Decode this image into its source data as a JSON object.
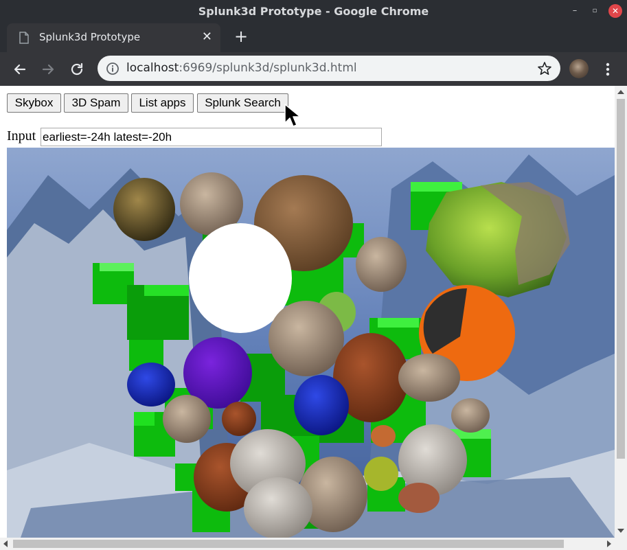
{
  "window": {
    "title": "Splunk3d Prototype - Google Chrome"
  },
  "tab": {
    "title": "Splunk3d Prototype"
  },
  "omnibox": {
    "host": "localhost",
    "rest": ":6969/splunk3d/splunk3d.html"
  },
  "page": {
    "buttons": {
      "skybox": "Skybox",
      "spam": "3D Spam",
      "list_apps": "List apps",
      "splunk_search": "Splunk Search"
    },
    "input_label": "Input",
    "input_value": "earliest=-24h latest=-20h"
  },
  "colors": {
    "cube_green": "#0dbb0d",
    "cube_dark": "#0a8a0a",
    "sky": "#5f7fb8",
    "chrome_dark": "#2b2e33"
  }
}
